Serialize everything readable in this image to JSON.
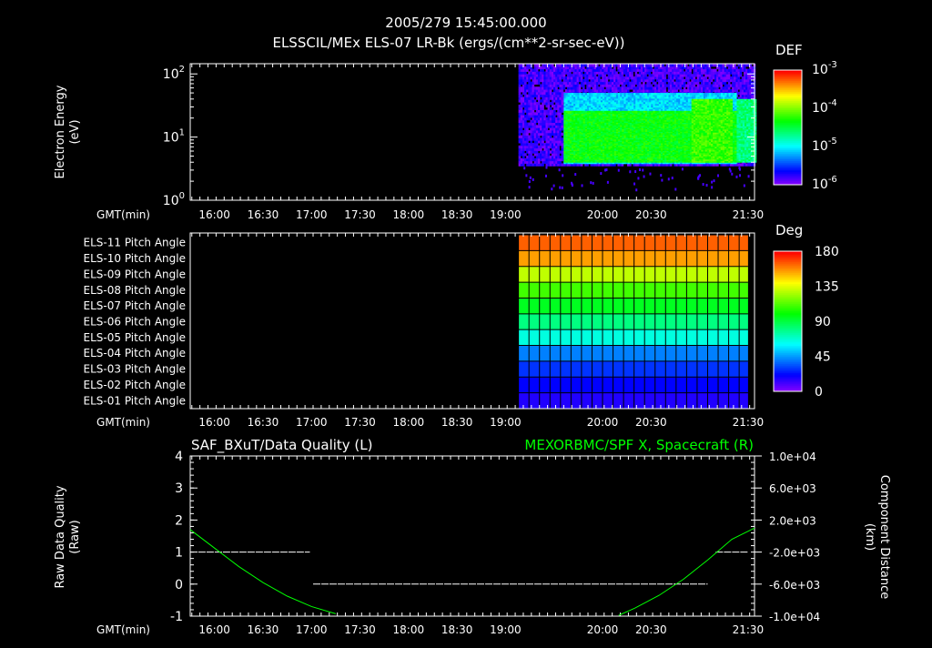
{
  "header": {
    "datetime": "2005/279 15:45:00.000",
    "panel1_title": "ELSSCIL/MEx ELS-07 LR-Bk  (ergs/(cm**2-sr-sec-eV))"
  },
  "time_axis": {
    "label": "GMT(min)",
    "ticks": [
      "16:00",
      "16:30",
      "17:00",
      "17:30",
      "18:00",
      "18:30",
      "19:00",
      "20:00",
      "20:30",
      "21:30"
    ],
    "tick_minutes": [
      960,
      990,
      1020,
      1050,
      1080,
      1110,
      1140,
      1200,
      1230,
      1290
    ],
    "range_minutes": [
      945,
      1294
    ]
  },
  "chart_data": [
    {
      "type": "heatmap",
      "title": "ELSSCIL/MEx ELS-07 LR-Bk  (ergs/(cm**2-sr-sec-eV))",
      "ylabel": "Electron Energy",
      "yunit": "(eV)",
      "yscale": "log",
      "ylim": [
        1,
        145
      ],
      "yticks": [
        {
          "base": "10",
          "exp": "0"
        },
        {
          "base": "10",
          "exp": "1"
        },
        {
          "base": "10",
          "exp": "2"
        }
      ],
      "colorbar": {
        "title": "DEF",
        "ticks": [
          {
            "base": "10",
            "exp": "-3"
          },
          {
            "base": "10",
            "exp": "-4"
          },
          {
            "base": "10",
            "exp": "-5"
          },
          {
            "base": "10",
            "exp": "-6"
          }
        ],
        "range": [
          1e-06,
          0.001
        ]
      },
      "regions": [
        {
          "start_min": 1148,
          "end_min": 1294,
          "emin": 3.5,
          "emax": 145,
          "level": 0.05
        },
        {
          "start_min": 1176,
          "end_min": 1282,
          "emin": 3.8,
          "emax": 50,
          "level": 0.3
        },
        {
          "start_min": 1176,
          "end_min": 1282,
          "emin": 4,
          "emax": 26,
          "level": 0.55
        },
        {
          "start_min": 1255,
          "end_min": 1280,
          "emin": 4,
          "emax": 40,
          "level": 0.6
        },
        {
          "start_min": 1283,
          "end_min": 1294,
          "emin": 4,
          "emax": 40,
          "level": 0.45
        }
      ]
    },
    {
      "type": "heatmap",
      "title": "Pitch Angle",
      "rows": [
        "ELS-11 Pitch Angle",
        "ELS-10 Pitch Angle",
        "ELS-09 Pitch Angle",
        "ELS-08 Pitch Angle",
        "ELS-07 Pitch Angle",
        "ELS-06 Pitch Angle",
        "ELS-05 Pitch Angle",
        "ELS-04 Pitch Angle",
        "ELS-03 Pitch Angle",
        "ELS-02 Pitch Angle",
        "ELS-01 Pitch Angle"
      ],
      "values_deg": [
        165,
        155,
        130,
        110,
        95,
        80,
        65,
        40,
        28,
        20,
        15
      ],
      "data_start_min": 1148,
      "data_end_min": 1290,
      "colorbar": {
        "title": "Deg",
        "ticks": [
          "180",
          "135",
          "90",
          "45",
          "0"
        ],
        "range": [
          0,
          180
        ]
      }
    },
    {
      "type": "line",
      "title_left": "SAF_BXuT/Data Quality (L)",
      "title_right": "MEXORBMC/SPF X, Spacecraft (R)",
      "ylabel_left": "Raw Data Quality",
      "yunit_left": "(Raw)",
      "ylabel_right": "Component Distance",
      "yunit_right": "(km)",
      "ylim_left": [
        -1,
        4
      ],
      "yticks_left": [
        "4",
        "3",
        "2",
        "1",
        "0",
        "-1"
      ],
      "ylim_right": [
        -10000,
        10000
      ],
      "yticks_right": [
        "1.0e+04",
        "6.0e+03",
        "2.0e+03",
        "-2.0e+03",
        "-6.0e+03",
        "-1.0e+04"
      ],
      "series": [
        {
          "name": "Data Quality",
          "color": "#ffffff",
          "segments": [
            {
              "x": [
                950,
                1019
              ],
              "y": 1
            },
            {
              "x": [
                1021,
                1265
              ],
              "y": 0
            },
            {
              "x": [
                1270,
                1290
              ],
              "y": 1
            }
          ]
        },
        {
          "name": "SPF X",
          "color": "#00ff00",
          "x": [
            945,
            960,
            975,
            990,
            1005,
            1020,
            1035,
            1045,
            1052,
            1200,
            1210,
            1220,
            1235,
            1250,
            1265,
            1280,
            1294
          ],
          "y": [
            800,
            -1500,
            -3800,
            -5800,
            -7500,
            -8800,
            -9700,
            -10100,
            -10300,
            -10300,
            -9900,
            -9000,
            -7400,
            -5400,
            -3000,
            -400,
            1000
          ]
        }
      ]
    }
  ]
}
